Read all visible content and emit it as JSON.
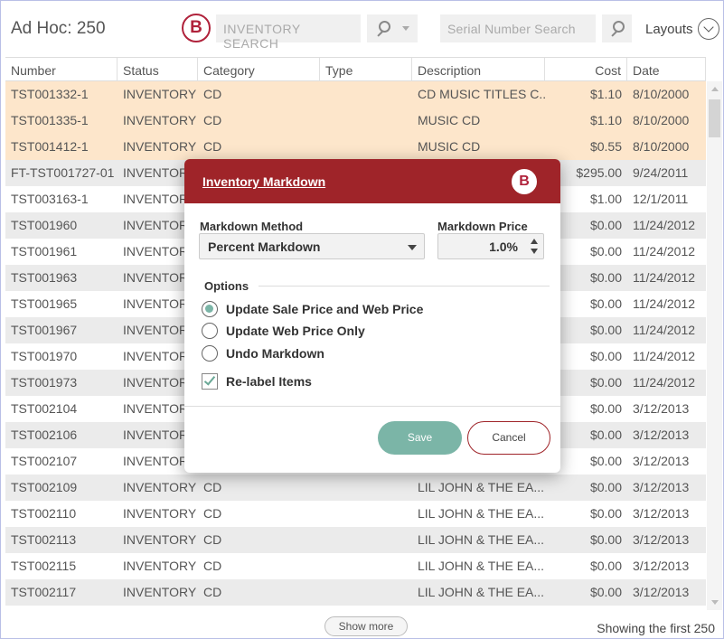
{
  "header": {
    "title": "Ad Hoc: 250",
    "logo_letter": "B",
    "inventory_search_placeholder": "INVENTORY SEARCH",
    "serial_search_placeholder": "Serial Number Search",
    "layouts_label": "Layouts"
  },
  "table": {
    "columns": [
      "Number",
      "Status",
      "Category",
      "Type",
      "Description",
      "Cost",
      "Date"
    ],
    "rows": [
      {
        "number": "TST001332-1",
        "status": "INVENTORY",
        "category": "CD",
        "type": "",
        "description": "CD MUSIC TITLES C...",
        "cost": "$1.10",
        "date": "8/10/2000",
        "selected": true
      },
      {
        "number": "TST001335-1",
        "status": "INVENTORY",
        "category": "CD",
        "type": "",
        "description": "MUSIC CD",
        "cost": "$1.10",
        "date": "8/10/2000",
        "selected": true
      },
      {
        "number": "TST001412-1",
        "status": "INVENTORY",
        "category": "CD",
        "type": "",
        "description": "MUSIC CD",
        "cost": "$0.55",
        "date": "8/10/2000",
        "selected": true
      },
      {
        "number": "FT-TST001727-01",
        "status": "INVENTORY",
        "category": "",
        "type": "",
        "description": "",
        "cost": "$295.00",
        "date": "9/24/2011",
        "selected": false
      },
      {
        "number": "TST003163-1",
        "status": "INVENTORY",
        "category": "",
        "type": "",
        "description": "",
        "cost": "$1.00",
        "date": "12/1/2011",
        "selected": false
      },
      {
        "number": "TST001960",
        "status": "INVENTORY",
        "category": "",
        "type": "",
        "description": "",
        "cost": "$0.00",
        "date": "11/24/2012",
        "selected": false
      },
      {
        "number": "TST001961",
        "status": "INVENTORY",
        "category": "",
        "type": "",
        "description": "",
        "cost": "$0.00",
        "date": "11/24/2012",
        "selected": false
      },
      {
        "number": "TST001963",
        "status": "INVENTORY",
        "category": "",
        "type": "",
        "description": "",
        "cost": "$0.00",
        "date": "11/24/2012",
        "selected": false
      },
      {
        "number": "TST001965",
        "status": "INVENTORY",
        "category": "",
        "type": "",
        "description": "",
        "cost": "$0.00",
        "date": "11/24/2012",
        "selected": false
      },
      {
        "number": "TST001967",
        "status": "INVENTORY",
        "category": "",
        "type": "",
        "description": "",
        "cost": "$0.00",
        "date": "11/24/2012",
        "selected": false
      },
      {
        "number": "TST001970",
        "status": "INVENTORY",
        "category": "",
        "type": "",
        "description": "",
        "cost": "$0.00",
        "date": "11/24/2012",
        "selected": false
      },
      {
        "number": "TST001973",
        "status": "INVENTORY",
        "category": "",
        "type": "",
        "description": "",
        "cost": "$0.00",
        "date": "11/24/2012",
        "selected": false
      },
      {
        "number": "TST002104",
        "status": "INVENTORY",
        "category": "",
        "type": "",
        "description": "",
        "cost": "$0.00",
        "date": "3/12/2013",
        "selected": false
      },
      {
        "number": "TST002106",
        "status": "INVENTORY",
        "category": "",
        "type": "",
        "description": "",
        "cost": "$0.00",
        "date": "3/12/2013",
        "selected": false
      },
      {
        "number": "TST002107",
        "status": "INVENTORY",
        "category": "",
        "type": "",
        "description": "",
        "cost": "$0.00",
        "date": "3/12/2013",
        "selected": false
      },
      {
        "number": "TST002109",
        "status": "INVENTORY",
        "category": "CD",
        "type": "",
        "description": "LIL JOHN & THE EA...",
        "cost": "$0.00",
        "date": "3/12/2013",
        "selected": false
      },
      {
        "number": "TST002110",
        "status": "INVENTORY",
        "category": "CD",
        "type": "",
        "description": "LIL JOHN & THE EA...",
        "cost": "$0.00",
        "date": "3/12/2013",
        "selected": false
      },
      {
        "number": "TST002113",
        "status": "INVENTORY",
        "category": "CD",
        "type": "",
        "description": "LIL JOHN & THE EA...",
        "cost": "$0.00",
        "date": "3/12/2013",
        "selected": false
      },
      {
        "number": "TST002115",
        "status": "INVENTORY",
        "category": "CD",
        "type": "",
        "description": "LIL JOHN & THE EA...",
        "cost": "$0.00",
        "date": "3/12/2013",
        "selected": false
      },
      {
        "number": "TST002117",
        "status": "INVENTORY",
        "category": "CD",
        "type": "",
        "description": "LIL JOHN & THE EA...",
        "cost": "$0.00",
        "date": "3/12/2013",
        "selected": false
      }
    ]
  },
  "footer": {
    "show_more": "Show more",
    "showing": "Showing the first 250"
  },
  "modal": {
    "title": "Inventory Markdown",
    "method_label": "Markdown Method",
    "method_value": "Percent Markdown",
    "price_label": "Markdown Price",
    "price_value": "1.0%",
    "options_label": "Options",
    "options": [
      {
        "label": "Update Sale Price and Web Price",
        "selected": true
      },
      {
        "label": "Update Web Price Only",
        "selected": false
      },
      {
        "label": "Undo Markdown",
        "selected": false
      }
    ],
    "relabel_label": "Re-label Items",
    "relabel_checked": true,
    "save_label": "Save",
    "cancel_label": "Cancel"
  },
  "colors": {
    "brand": "#9f2429",
    "accent": "#7bb5a7",
    "selected_row": "#fde6cb",
    "alt_row": "#ebebeb"
  }
}
